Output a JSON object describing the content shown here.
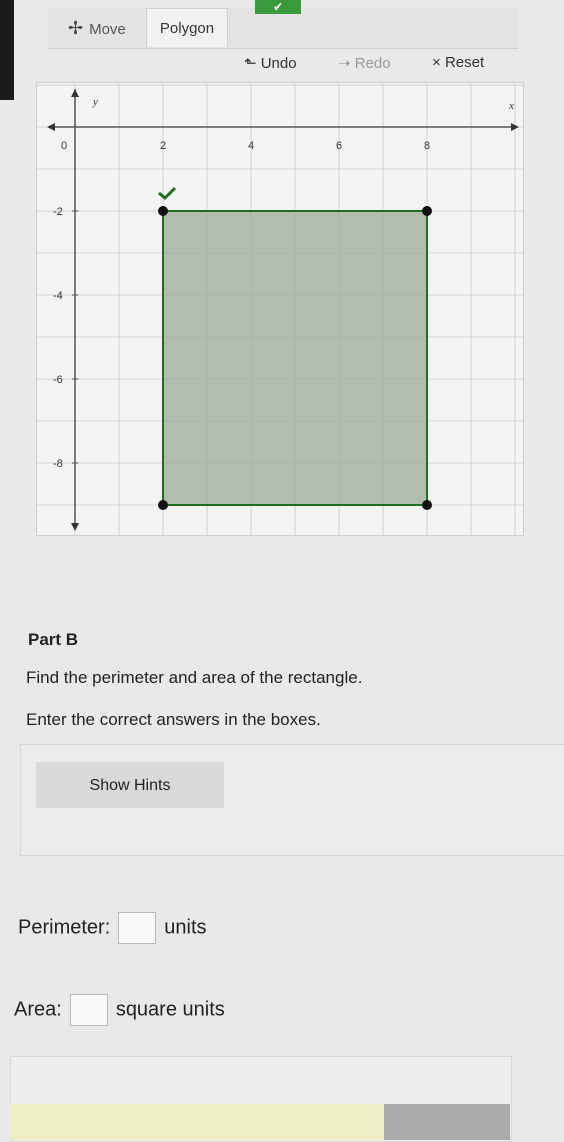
{
  "toolbar": {
    "move_label": "Move",
    "polygon_label": "Polygon"
  },
  "history": {
    "undo_label": "Undo",
    "redo_label": "Redo",
    "reset_label": "Reset"
  },
  "graph": {
    "x_axis_label": "x",
    "y_axis_label": "y",
    "x_ticks": [
      "0",
      "2",
      "4",
      "6",
      "8"
    ],
    "y_ticks": [
      "-2",
      "-4",
      "-6",
      "-8"
    ],
    "grid_x_range": [
      -1,
      10
    ],
    "grid_y_range": [
      -9,
      1
    ],
    "polygon_vertices": [
      [
        2,
        -2
      ],
      [
        8,
        -2
      ],
      [
        8,
        -9
      ],
      [
        2,
        -9
      ]
    ],
    "polygon_fill": "#9cab99",
    "polygon_stroke": "#1f6d1f",
    "vertex_color": "#111111"
  },
  "question": {
    "part_title": "Part B",
    "prompt": "Find the perimeter and area of the rectangle.",
    "instruction": "Enter the correct answers in the boxes.",
    "hint_button": "Show Hints",
    "perimeter_label": "Perimeter:",
    "perimeter_unit": "units",
    "area_label": "Area:",
    "area_unit": "square units"
  }
}
